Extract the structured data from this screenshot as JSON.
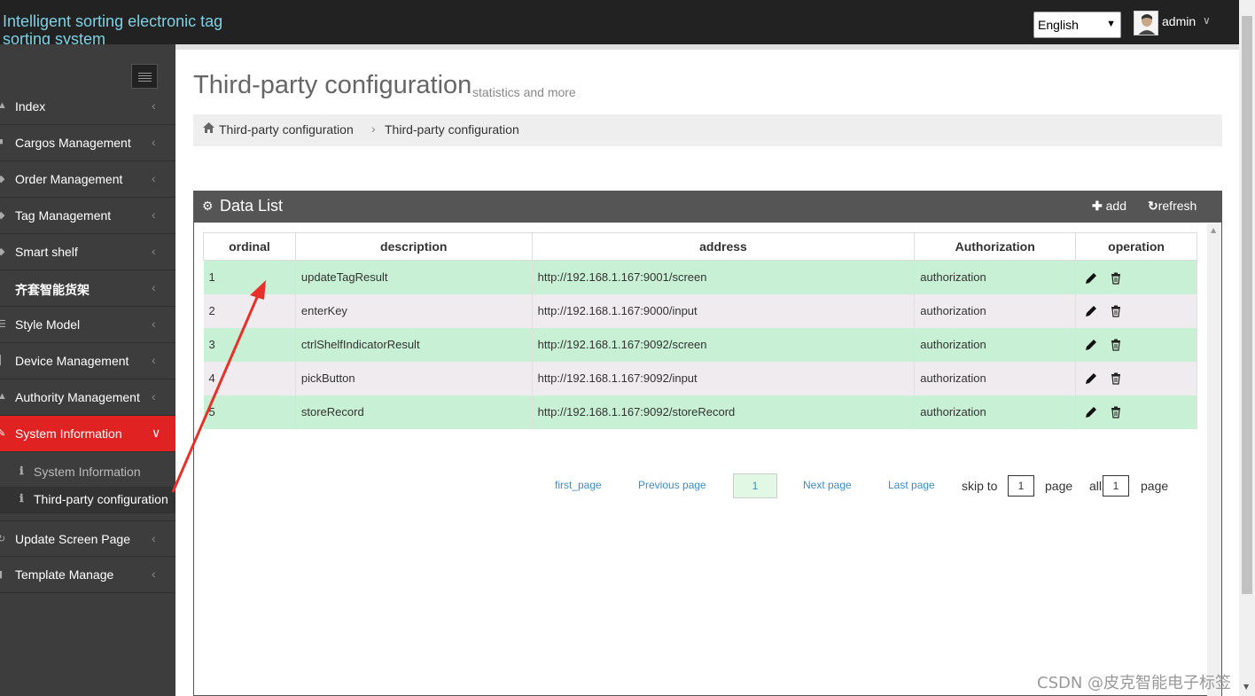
{
  "app": {
    "brand": "Intelligent sorting electronic tag sorting system",
    "language": "English",
    "user_name": "admin"
  },
  "sidebar": {
    "items": [
      {
        "label": "Index"
      },
      {
        "label": "Cargos Management"
      },
      {
        "label": "Order Management"
      },
      {
        "label": "Tag Management"
      },
      {
        "label": "Smart shelf"
      },
      {
        "label": "齐套智能货架"
      },
      {
        "label": "Style Model"
      },
      {
        "label": "Device Management"
      },
      {
        "label": "Authority Management"
      },
      {
        "label": "System Information"
      },
      {
        "label": "Update Screen Page"
      },
      {
        "label": "Template Manage"
      }
    ],
    "sub_items": [
      {
        "label": "System Information"
      },
      {
        "label": "Third-party configuration"
      }
    ]
  },
  "page": {
    "title": "Third-party configuration",
    "subtitle": "statistics and more",
    "breadcrumb": [
      "Third-party configuration",
      "Third-party configuration"
    ]
  },
  "portlet": {
    "title": "Data List",
    "add_label": "add",
    "refresh_label": "refresh"
  },
  "table": {
    "columns": [
      "ordinal",
      "description",
      "address",
      "Authorization",
      "operation"
    ],
    "rows": [
      {
        "ordinal": "1",
        "description": "updateTagResult",
        "address": "http://192.168.1.167:9001/screen",
        "authorization": "authorization"
      },
      {
        "ordinal": "2",
        "description": "enterKey",
        "address": "http://192.168.1.167:9000/input",
        "authorization": "authorization"
      },
      {
        "ordinal": "3",
        "description": "ctrlShelfIndicatorResult",
        "address": "http://192.168.1.167:9092/screen",
        "authorization": "authorization"
      },
      {
        "ordinal": "4",
        "description": "pickButton",
        "address": "http://192.168.1.167:9092/input",
        "authorization": "authorization"
      },
      {
        "ordinal": "5",
        "description": "storeRecord",
        "address": "http://192.168.1.167:9092/storeRecord",
        "authorization": "authorization"
      }
    ]
  },
  "pagination": {
    "first": "first_page",
    "previous": "Previous page",
    "current": "1",
    "next": "Next page",
    "last": "Last page",
    "skip_to": "skip to",
    "skip_value": "1",
    "page_word": "page",
    "all_word": "all",
    "total": "1",
    "page_word_2": "page"
  },
  "watermark": "CSDN @皮克智能电子标签",
  "colors": {
    "topbar": "#222222",
    "sidebar": "#3d3d3d",
    "active_nav": "#e02222",
    "row_green": "#c8f0d4",
    "row_pink": "#f0ebef",
    "portlet_head": "#555555",
    "brand": "#7ed0e6",
    "link": "#3a8dc4",
    "annotation_arrow": "#e8302a"
  }
}
